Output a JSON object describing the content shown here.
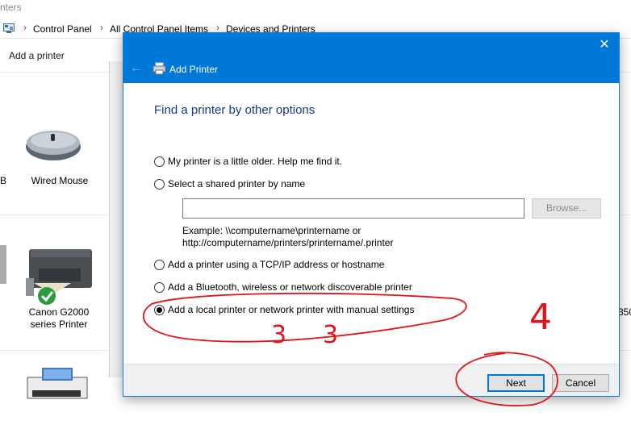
{
  "background": {
    "window_title": "nters",
    "breadcrumb": [
      "Control Panel",
      "All Control Panel Items",
      "Devices and Printers"
    ],
    "toolbar": {
      "add_printer": "Add a printer"
    },
    "devices": [
      {
        "label": "B"
      },
      {
        "label": "Wired Mouse"
      },
      {
        "label": "Canon G2000\nseries Printer"
      },
      {
        "label": "350"
      }
    ]
  },
  "dialog": {
    "title": "Add Printer",
    "close_glyph": "✕",
    "back_glyph": "←",
    "heading": "Find a printer by other options",
    "options": [
      {
        "label": "My printer is a little older. Help me find it.",
        "checked": false
      },
      {
        "label": "Select a shared printer by name",
        "checked": false
      },
      {
        "label": "Add a printer using a TCP/IP address or hostname",
        "checked": false
      },
      {
        "label": "Add a Bluetooth, wireless or network discoverable printer",
        "checked": false
      },
      {
        "label": "Add a local printer or network printer with manual settings",
        "checked": true
      }
    ],
    "shared_name_value": "",
    "browse_label": "Browse...",
    "example_line1": "Example: \\\\computername\\printername or",
    "example_line2": "http://computername/printers/printername/.printer",
    "next_label": "Next",
    "cancel_label": "Cancel"
  },
  "annotations": {
    "color": "#e3121b",
    "texts": [
      "3",
      "3",
      "4"
    ]
  }
}
